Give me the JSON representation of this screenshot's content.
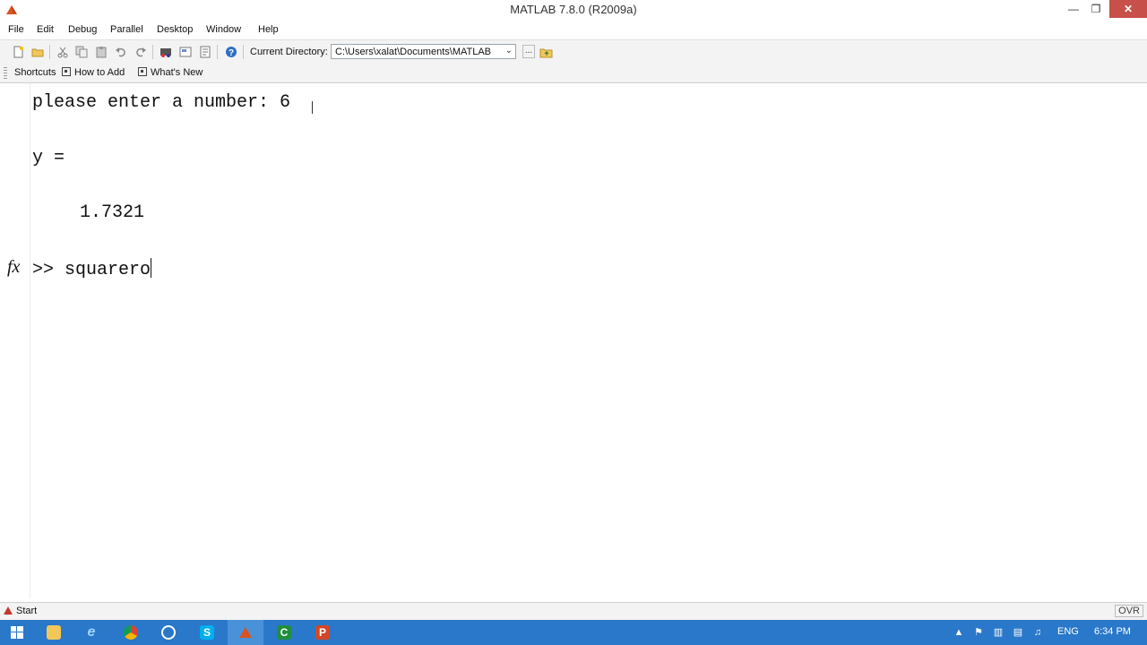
{
  "window": {
    "title": "MATLAB  7.8.0 (R2009a)"
  },
  "menu": {
    "items": [
      "File",
      "Edit",
      "Debug",
      "Parallel",
      "Desktop",
      "Window",
      "Help"
    ]
  },
  "toolbar": {
    "current_directory_label": "Current Directory:",
    "current_directory_value": "C:\\Users\\xalat\\Documents\\MATLAB",
    "browse_label": "..."
  },
  "shortcuts": {
    "items": [
      "Shortcuts",
      "How to Add",
      "What's New"
    ]
  },
  "command_window": {
    "lines": [
      "please enter a number: 6",
      "y =",
      "1.7321"
    ],
    "prompt": ">>",
    "current_input": "squarero",
    "fx_label": "fx"
  },
  "statusbar": {
    "start_label": "Start",
    "ovr_label": "OVR"
  },
  "taskbar": {
    "language": "ENG",
    "time": "6:34 PM"
  }
}
